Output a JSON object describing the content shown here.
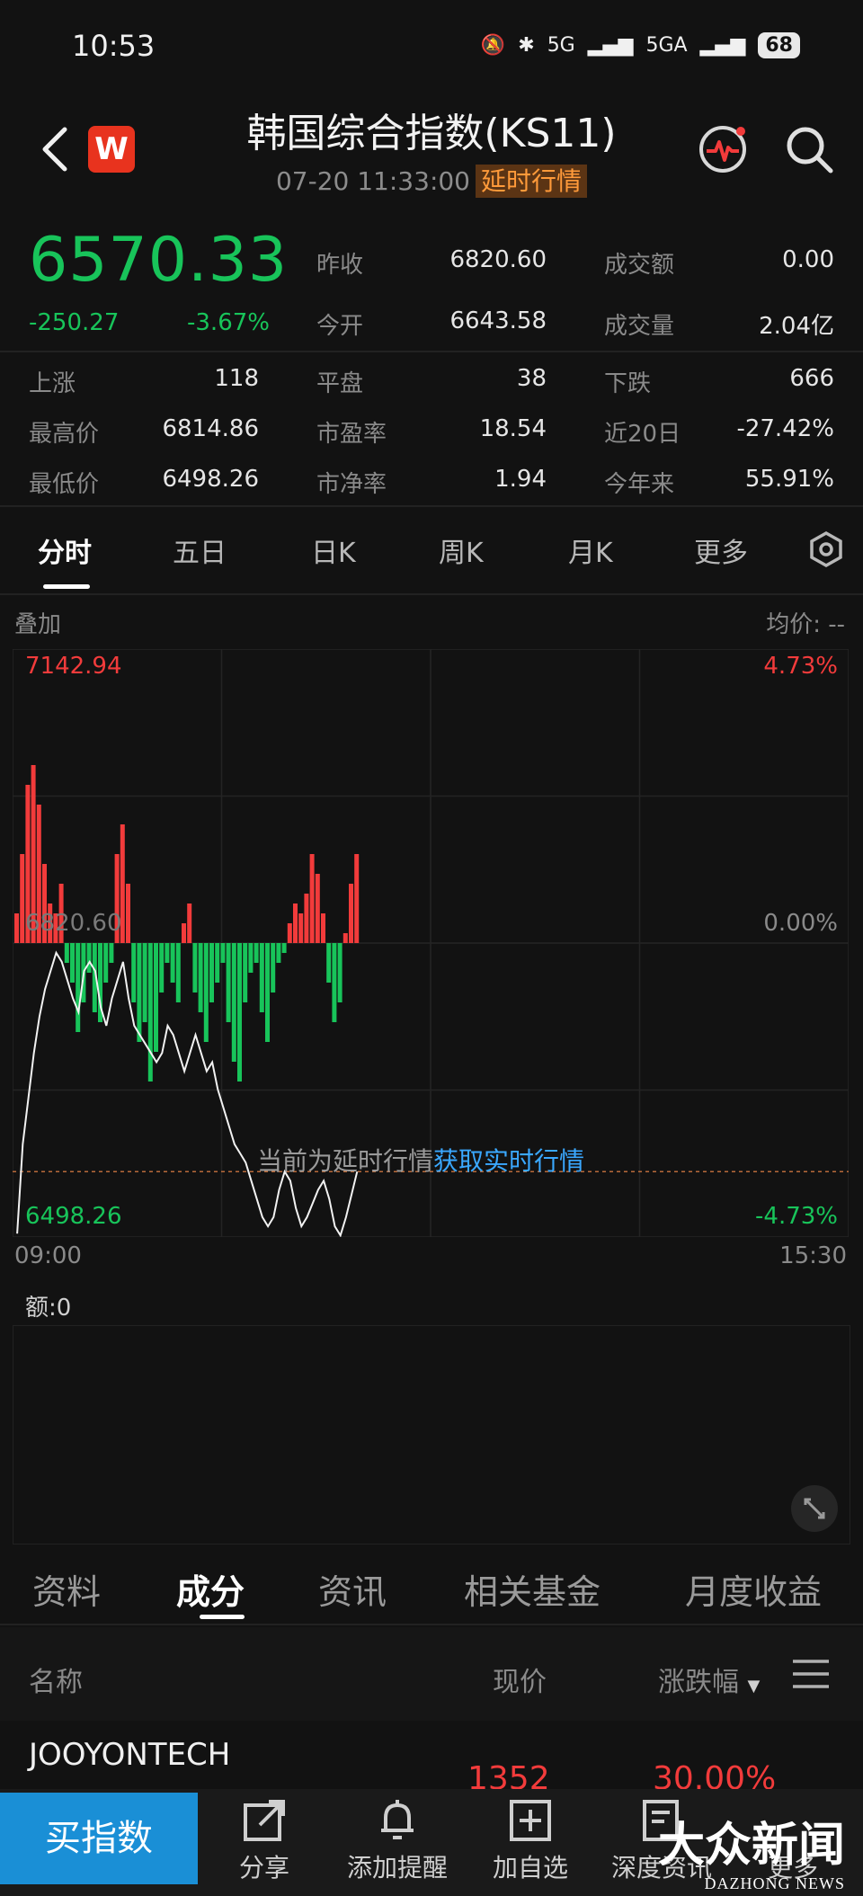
{
  "status_bar": {
    "time": "10:53",
    "signal1": "5G",
    "signal2": "5GA",
    "battery": "68"
  },
  "header": {
    "logo_letter": "W",
    "title": "韩国综合指数(KS11)",
    "datetime": "07-20 11:33:00",
    "delay_tag": "延时行情"
  },
  "quote": {
    "price": "6570.33",
    "change": "-250.27",
    "change_pct": "-3.67%",
    "prev_close_label": "昨收",
    "prev_close": "6820.60",
    "open_label": "今开",
    "open": "6643.58",
    "turnover_label": "成交额",
    "turnover": "0.00",
    "volume_label": "成交量",
    "volume": "2.04亿",
    "up_label": "上涨",
    "up": "118",
    "flat_label": "平盘",
    "flat": "38",
    "down_label": "下跌",
    "down": "666",
    "high_label": "最高价",
    "high": "6814.86",
    "pe_label": "市盈率",
    "pe": "18.54",
    "d20_label": "近20日",
    "d20": "-27.42%",
    "low_label": "最低价",
    "low": "6498.26",
    "pb_label": "市净率",
    "pb": "1.94",
    "ytd_label": "今年来",
    "ytd": "55.91%"
  },
  "chart_tabs": [
    "分时",
    "五日",
    "日K",
    "周K",
    "月K",
    "更多"
  ],
  "chart": {
    "overlay_label": "叠加",
    "avg_label": "均价: --",
    "y_top": "7142.94",
    "y_mid": "6820.60",
    "y_bottom": "6498.26",
    "pct_top": "4.73%",
    "pct_mid": "0.00%",
    "pct_bottom": "-4.73%",
    "x_start": "09:00",
    "x_end": "15:30",
    "notice_text": "当前为延时行情",
    "notice_link": "获取实时行情",
    "volume_label": "额:0"
  },
  "chart_data": {
    "type": "line",
    "xlabel": "",
    "ylabel": "",
    "ylim": [
      6498.26,
      7142.94
    ],
    "xlim": [
      "09:00",
      "15:30"
    ],
    "prev_close": 6820.6,
    "x_ticks": [
      "09:00",
      "15:30"
    ],
    "y_ticks": [
      7142.94,
      6820.6,
      6498.26
    ],
    "series": [
      {
        "values": [
          6502,
          6600,
          6650,
          6700,
          6740,
          6770,
          6790,
          6810,
          6800,
          6780,
          6760,
          6745,
          6790,
          6800,
          6790,
          6750,
          6730,
          6760,
          6780,
          6800,
          6760,
          6730,
          6720,
          6710,
          6700,
          6690,
          6700,
          6730,
          6720,
          6700,
          6680,
          6700,
          6720,
          6700,
          6680,
          6690,
          6660,
          6640,
          6620,
          6600,
          6590,
          6580,
          6560,
          6540,
          6520,
          6510,
          6520,
          6550,
          6570,
          6560,
          6530,
          6510,
          6520,
          6535,
          6550,
          6560,
          6540,
          6510,
          6500,
          6520,
          6545,
          6570
        ]
      }
    ],
    "bars": {
      "description_free": true,
      "values": [
        0.3,
        0.9,
        1.6,
        1.8,
        1.4,
        0.8,
        0.4,
        0.3,
        0.6,
        -0.2,
        -0.4,
        -0.9,
        -0.6,
        -0.3,
        -0.7,
        -0.8,
        -0.4,
        -0.2,
        0.9,
        1.2,
        0.6,
        -0.6,
        -1.0,
        -0.8,
        -1.4,
        -1.1,
        -0.5,
        -0.2,
        -0.4,
        -0.6,
        0.2,
        0.4,
        -0.5,
        -0.7,
        -1.0,
        -0.6,
        -0.4,
        -0.2,
        -0.8,
        -1.2,
        -1.4,
        -0.6,
        -0.3,
        -0.2,
        -0.7,
        -1.0,
        -0.5,
        -0.2,
        -0.1,
        0.2,
        0.4,
        0.3,
        0.5,
        0.9,
        0.7,
        0.3,
        -0.4,
        -0.8,
        -0.6,
        0.1,
        0.6,
        0.9
      ]
    }
  },
  "section_tabs": [
    "资料",
    "成分",
    "资讯",
    "相关基金",
    "月度收益"
  ],
  "table": {
    "col_name": "名称",
    "col_price": "现价",
    "col_change": "涨跌幅",
    "rows": [
      {
        "name": "JOOYONTECH",
        "price": "1352",
        "change": "30.00%"
      }
    ]
  },
  "bottom_bar": {
    "buy": "买指数",
    "share": "分享",
    "alert": "添加提醒",
    "watch": "加自选",
    "deep": "深度资讯",
    "more": "更多"
  },
  "watermark": {
    "cn": "大众新闻",
    "en": "DAZHONG NEWS"
  },
  "colors": {
    "up": "#f23b3b",
    "down": "#18c45a",
    "accent": "#1a8fd6",
    "link": "#3aa8ff",
    "delay_tag": "#ff9a3a"
  }
}
